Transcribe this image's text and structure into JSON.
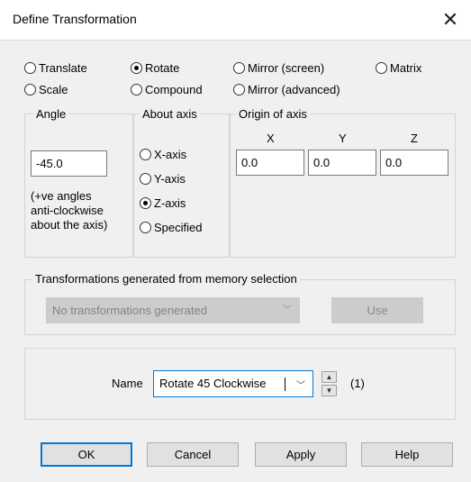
{
  "window": {
    "title": "Define Transformation",
    "close_glyph": "✕"
  },
  "types": {
    "translate": "Translate",
    "rotate": "Rotate",
    "mirror_screen": "Mirror (screen)",
    "matrix": "Matrix",
    "scale": "Scale",
    "compound": "Compound",
    "mirror_advanced": "Mirror (advanced)",
    "selected": "rotate"
  },
  "angle": {
    "group_label": "Angle",
    "value": "-45.0",
    "hint_line1": "(+ve angles",
    "hint_line2": "anti-clockwise",
    "hint_line3": "about the axis)"
  },
  "about_axis": {
    "group_label": "About axis",
    "x": "X-axis",
    "y": "Y-axis",
    "z": "Z-axis",
    "specified": "Specified",
    "selected": "z"
  },
  "origin": {
    "group_label": "Origin of axis",
    "x_label": "X",
    "y_label": "Y",
    "z_label": "Z",
    "x_value": "0.0",
    "y_value": "0.0",
    "z_value": "0.0"
  },
  "memory": {
    "group_label": "Transformations generated from memory selection",
    "dropdown_value": "No transformations generated",
    "use_label": "Use"
  },
  "name_section": {
    "label": "Name",
    "value": "Rotate 45 Clockwise",
    "count": "(1)"
  },
  "buttons": {
    "ok": "OK",
    "cancel": "Cancel",
    "apply": "Apply",
    "help": "Help"
  },
  "colors": {
    "accent": "#0078d7",
    "dialog_bg": "#f0f0f0",
    "titlebar_bg": "#ffffff"
  }
}
